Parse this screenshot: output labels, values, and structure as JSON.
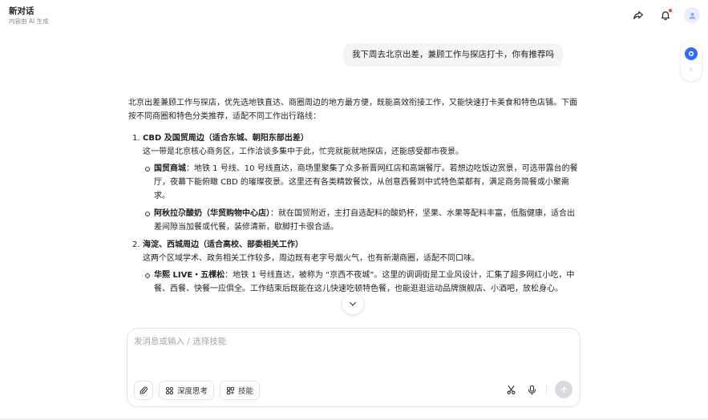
{
  "header": {
    "title": "新对话",
    "subtitle": "内容由 AI 生成",
    "icons": [
      "share-icon",
      "bell-icon",
      "avatar-icon"
    ]
  },
  "side_widget": {
    "icons": [
      "assistant-icon",
      "drag-handle-icon"
    ],
    "dots": "⠿"
  },
  "user_message": "我下周去北京出差，兼顾工作与探店打卡，你有推荐吗",
  "answer": {
    "intro": "北京出差兼顾工作与探店，优先选地铁直达、商圈周边的地方最方便，既能高效衔接工作，又能快速打卡美食和特色店铺。下面按不同商圈和特色分类推荐，适配不同工作出行路线：",
    "sections": [
      {
        "num": "1.",
        "title": "CBD 及国贸周边（适合东城、朝阳东部出差）",
        "desc": "这一带是北京核心商务区，工作洽谈多集中于此，忙完就能就地探店，还能感受都市夜景。",
        "items": [
          {
            "name": "国贸商城",
            "text": "：地铁 1 号线、10 号线直达，商场里聚集了众多新晋网红店和高端餐厅。若想边吃饭边赏景，可选带露台的餐厅，夜幕下能俯瞰 CBD 的璀璨夜景。这里还有各类精致餐饮，从创意西餐到中式特色菜都有，满足商务简餐或小聚需求。"
          },
          {
            "name": "阿秋拉尕酸奶（华贸购物中心店）",
            "text": "：就在国贸附近，主打自选配料的酸奶杯，坚果、水果等配料丰富，低脂健康，适合出差间隙当加餐或代餐，装修清新，歇脚打卡很合适。"
          }
        ]
      },
      {
        "num": "2.",
        "title": "海淀、西城周边（适合高校、部委相关工作）",
        "desc": "这两个区域学术、政务相关工作较多，周边既有老字号烟火气，也有新潮商圈，适配不同口味。",
        "items": [
          {
            "name": "华熙 LIVE・五棵松",
            "text": "：地铁 1 号线直达，被称为 “京西不夜城”。这里的调调街是工业风设计，汇集了超多网红小吃，中餐、西餐、快餐一应俱全。工作结束后既能在这儿快速吃顿特色餐，也能逛逛运动品牌旗舰店、小酒吧，放松身心。"
          }
        ]
      }
    ]
  },
  "input": {
    "placeholder": "发消息或输入 / 选择技能",
    "value": ""
  },
  "toolbar": {
    "attach_icon": "paperclip-icon",
    "deep_think_label": "深度思考",
    "skills_label": "技能",
    "scissors_icon": "scissors-icon",
    "mic_icon": "microphone-icon",
    "send_icon": "send-arrow-icon"
  },
  "colors": {
    "accent": "#2f6bff",
    "bell_dot": "#f04438",
    "user_bubble_bg": "#f3f4f6",
    "send_disabled": "#d9d9de"
  }
}
